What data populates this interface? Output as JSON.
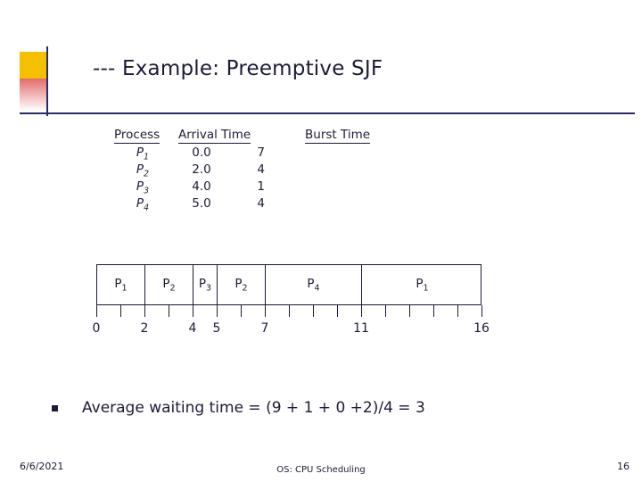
{
  "slide": {
    "title": "--- Example: Preemptive SJF",
    "accent_dark": "#1c1c38",
    "accent_yellow": "#f5c000",
    "accent_red": "#e46b6b"
  },
  "process_table": {
    "headers": [
      "Process",
      "Arrival Time",
      "Burst Time"
    ],
    "rows": [
      {
        "pid": "P",
        "pid_sub": "1",
        "arrival": "0.0",
        "burst": "7"
      },
      {
        "pid": "P",
        "pid_sub": "2",
        "arrival": "2.0",
        "burst": "4"
      },
      {
        "pid": "P",
        "pid_sub": "3",
        "arrival": "4.0",
        "burst": "1"
      },
      {
        "pid": "P",
        "pid_sub": "4",
        "arrival": "5.0",
        "burst": "4"
      }
    ]
  },
  "gantt": {
    "segments": [
      {
        "label": "P",
        "sub": "1",
        "start": 0,
        "end": 2
      },
      {
        "label": "P",
        "sub": "2",
        "start": 2,
        "end": 4
      },
      {
        "label": "P",
        "sub": "3",
        "start": 4,
        "end": 5
      },
      {
        "label": "P",
        "sub": "2",
        "start": 5,
        "end": 7
      },
      {
        "label": "P",
        "sub": "4",
        "start": 7,
        "end": 11
      },
      {
        "label": "P",
        "sub": "1",
        "start": 11,
        "end": 16
      }
    ],
    "axis_labels": [
      "0",
      "2",
      "4",
      "5",
      "7",
      "11",
      "16"
    ],
    "axis_values": [
      0,
      2,
      4,
      5,
      7,
      11,
      16
    ],
    "axis_min": 0,
    "axis_max": 16
  },
  "bullet": {
    "text": "Average waiting time = (9 + 1 + 0 +2)/4 = 3"
  },
  "footer": {
    "date": "6/6/2021",
    "center": "OS: CPU Scheduling",
    "page": "16"
  }
}
